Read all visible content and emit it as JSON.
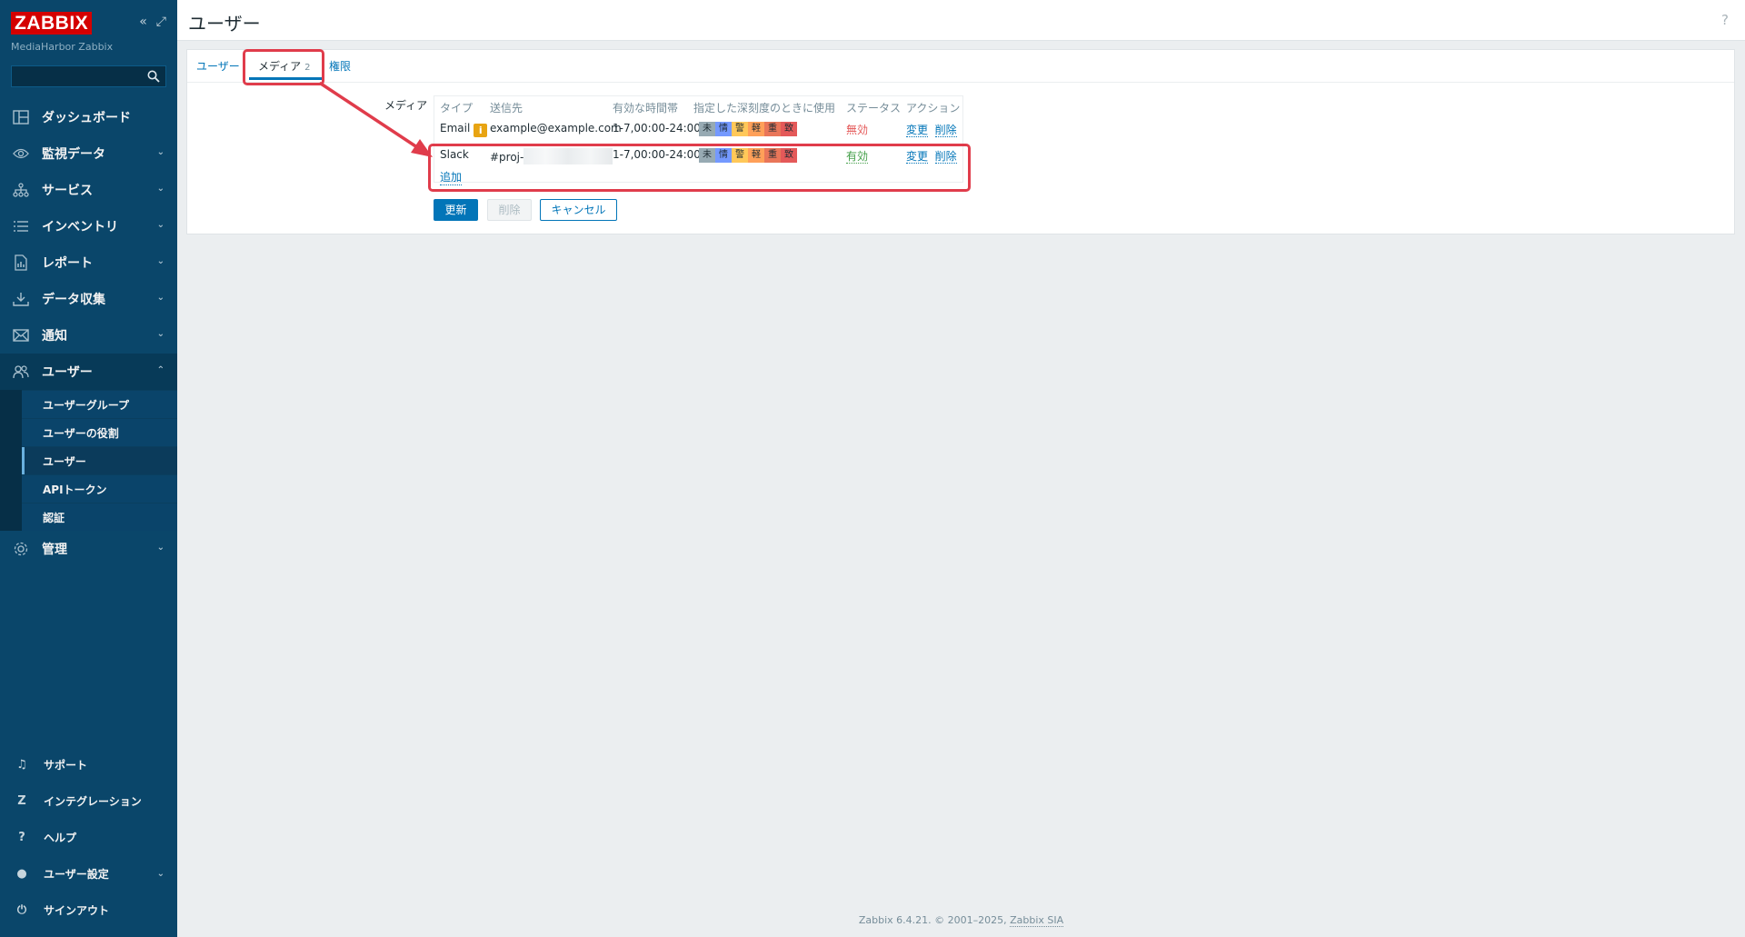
{
  "sidebar": {
    "logo": "ZABBIX",
    "server_name": "MediaHarbor Zabbix",
    "search_placeholder": "",
    "menu": [
      {
        "label": "ダッシュボード",
        "icon": "dashboard-icon"
      },
      {
        "label": "監視データ",
        "icon": "eye-icon",
        "chevron": "⌄"
      },
      {
        "label": "サービス",
        "icon": "services-icon",
        "chevron": "⌄"
      },
      {
        "label": "インベントリ",
        "icon": "list-icon",
        "chevron": "⌄"
      },
      {
        "label": "レポート",
        "icon": "report-icon",
        "chevron": "⌄"
      },
      {
        "label": "データ収集",
        "icon": "download-icon",
        "chevron": "⌄"
      },
      {
        "label": "通知",
        "icon": "envelope-icon",
        "chevron": "⌄"
      },
      {
        "label": "ユーザー",
        "icon": "users-icon",
        "chevron": "⌃"
      }
    ],
    "submenu": [
      {
        "label": "ユーザーグループ"
      },
      {
        "label": "ユーザーの役割"
      },
      {
        "label": "ユーザー"
      },
      {
        "label": "APIトークン"
      },
      {
        "label": "認証"
      }
    ],
    "admin": {
      "label": "管理",
      "chevron": "⌄"
    },
    "bottom": [
      {
        "label": "サポート",
        "icon": "headset-icon",
        "glyph": "♫"
      },
      {
        "label": "インテグレーション",
        "icon": "integration-icon",
        "glyph": "Z"
      },
      {
        "label": "ヘルプ",
        "icon": "help-icon",
        "glyph": "?"
      },
      {
        "label": "ユーザー設定",
        "icon": "user-icon",
        "glyph": "●",
        "chevron": "⌄"
      },
      {
        "label": "サインアウト",
        "icon": "power-icon",
        "glyph": "⏻"
      }
    ]
  },
  "header": {
    "title": "ユーザー",
    "help": "?"
  },
  "tabs": [
    {
      "label": "ユーザー"
    },
    {
      "label": "メディア",
      "count": "2"
    },
    {
      "label": "権限"
    }
  ],
  "form": {
    "media_label": "メディア",
    "columns": [
      "タイプ",
      "送信先",
      "有効な時間帯",
      "指定した深刻度のときに使用",
      "ステータス",
      "アクション"
    ],
    "rows": [
      {
        "type": "Email",
        "info_icon": "i",
        "sendto": "example@example.com",
        "period": "1-7,00:00-24:00",
        "status": "無効",
        "edit": "変更",
        "remove": "削除"
      },
      {
        "type": "Slack",
        "sendto": "#proj-",
        "period": "1-7,00:00-24:00",
        "status": "有効",
        "edit": "変更",
        "remove": "削除"
      }
    ],
    "severity_labels": [
      "未",
      "情",
      "警",
      "軽",
      "重",
      "致"
    ],
    "severity_colors": [
      "#97aab3",
      "#7499ff",
      "#ffc859",
      "#ffa059",
      "#e97659",
      "#e45959"
    ],
    "add_link": "追加"
  },
  "buttons": {
    "update": "更新",
    "delete": "削除",
    "cancel": "キャンセル"
  },
  "footer": {
    "text": "Zabbix 6.4.21. © 2001–2025, ",
    "link": "Zabbix SIA"
  },
  "colors": {
    "sidebar_bg": "#0a466a",
    "accent": "#0275b8",
    "annotation": "#e03c4b"
  }
}
